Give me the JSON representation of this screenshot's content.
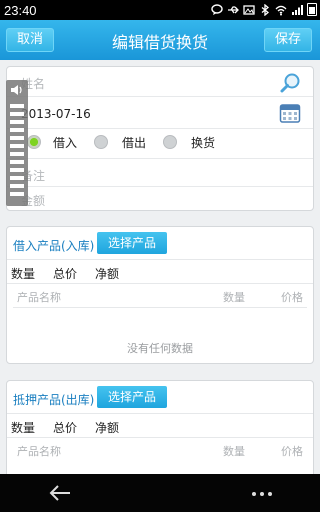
{
  "status_bar": {
    "time": "23:40",
    "icons": [
      "chat-bubble-icon",
      "usb-icon",
      "image-icon",
      "bluetooth-icon",
      "wifi-icon",
      "signal-icon",
      "battery-icon"
    ]
  },
  "header": {
    "title": "编辑借货换货",
    "cancel_label": "取消",
    "save_label": "保存",
    "color": "#1a96d8"
  },
  "form": {
    "name_placeholder": "姓名",
    "date_value": "2013-07-16",
    "radio_options": [
      {
        "label": "借入",
        "selected": true
      },
      {
        "label": "借出",
        "selected": false
      },
      {
        "label": "换货",
        "selected": false
      }
    ],
    "note_placeholder": "备注",
    "amount_placeholder": "金额"
  },
  "section_in": {
    "title": "借入产品(入库)",
    "select_label": "选择产品",
    "stats": [
      "数量",
      "总价",
      "净额"
    ],
    "columns": {
      "name": "产品名称",
      "qty": "数量",
      "price": "价格"
    },
    "empty": "没有任何数据"
  },
  "section_out": {
    "title": "抵押产品(出库)",
    "select_label": "选择产品",
    "stats": [
      "数量",
      "总价",
      "净额"
    ],
    "columns": {
      "name": "产品名称",
      "qty": "数量",
      "price": "价格"
    }
  }
}
